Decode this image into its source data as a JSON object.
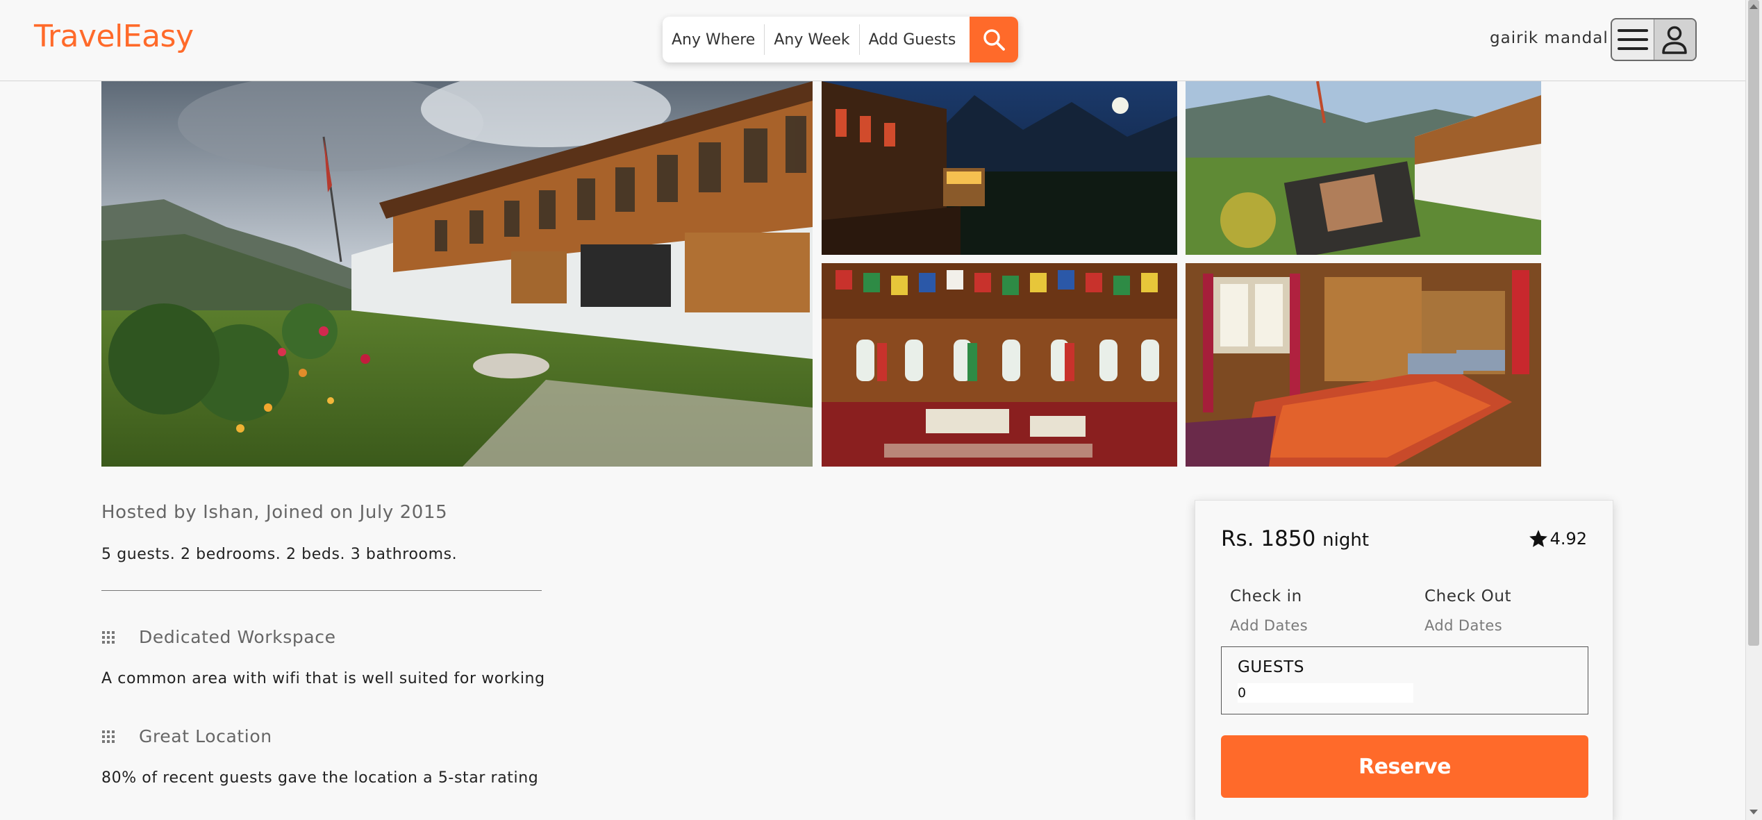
{
  "header": {
    "logo": "TravelEasy",
    "search": {
      "where": "Any Where",
      "week": "Any Week",
      "guests": "Add Guests"
    },
    "username": "gairik mandal"
  },
  "listing": {
    "hosted_by": "Hosted by Ishan, Joined on July 2015",
    "summary": "5 guests. 2 bedrooms. 2 beds. 3 bathrooms.",
    "features": [
      {
        "title": "Dedicated Workspace",
        "description": "A common area with wifi that is well suited for working",
        "icon": "grid-icon"
      },
      {
        "title": "Great Location",
        "description": "80% of recent guests gave the location a 5-star rating",
        "icon": "grid-icon"
      }
    ]
  },
  "booking": {
    "price": "Rs. 1850",
    "price_unit": "night",
    "rating": "4.92",
    "check_in_label": "Check in",
    "check_in_value": "Add Dates",
    "check_out_label": "Check Out",
    "check_out_value": "Add Dates",
    "guests_label": "GUESTS",
    "guests_value": "0",
    "reserve_label": "Reserve"
  },
  "colors": {
    "accent": "#ff6a2a",
    "background": "#f8f8f8"
  }
}
